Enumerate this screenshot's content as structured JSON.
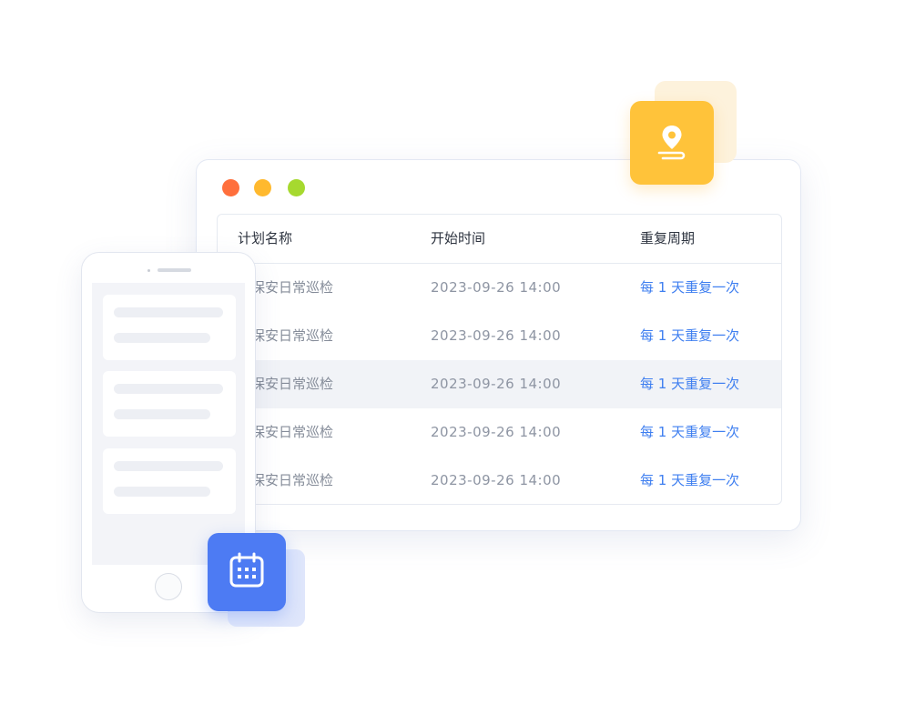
{
  "window": {
    "controls": [
      "close",
      "minimize",
      "maximize"
    ],
    "table": {
      "headers": {
        "plan_name": "计划名称",
        "start_time": "开始时间",
        "repeat_cycle": "重复周期"
      },
      "rows": [
        {
          "plan_name": "业保安日常巡检",
          "start_time": "2023-09-26 14:00",
          "repeat_cycle": "每 1 天重复一次"
        },
        {
          "plan_name": "业保安日常巡检",
          "start_time": "2023-09-26 14:00",
          "repeat_cycle": "每 1 天重复一次"
        },
        {
          "plan_name": "业保安日常巡检",
          "start_time": "2023-09-26 14:00",
          "repeat_cycle": "每 1 天重复一次"
        },
        {
          "plan_name": "业保安日常巡检",
          "start_time": "2023-09-26 14:00",
          "repeat_cycle": "每 1 天重复一次"
        },
        {
          "plan_name": "业保安日常巡检",
          "start_time": "2023-09-26 14:00",
          "repeat_cycle": "每 1 天重复一次"
        }
      ],
      "highlighted_row": 2
    }
  },
  "icons": {
    "location": "location-pin-icon",
    "calendar": "calendar-icon"
  },
  "colors": {
    "dot_red": "#ff6f3c",
    "dot_yellow": "#ffb92e",
    "dot_green": "#a6d92f",
    "accent_blue": "#3f7ff0",
    "badge_yellow": "#ffc33a",
    "badge_blue": "#4d7bf3"
  }
}
